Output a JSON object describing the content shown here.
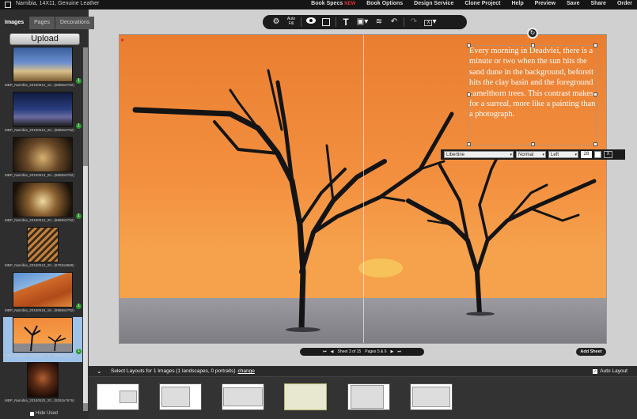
{
  "window": {
    "title": "Namibia, 14X11, Genuine Leather",
    "menu": [
      "Book Specs",
      "Book Options",
      "Design Service",
      "Clone Project",
      "Help",
      "Preview",
      "Save",
      "Share",
      "Order"
    ],
    "menu_new_badge": "NEW"
  },
  "sidebar": {
    "tabs": [
      "Images",
      "Pages",
      "Decorations"
    ],
    "active_tab": "Images",
    "upload_label": "Upload",
    "hide_used_label": "Hide Used",
    "thumbs": [
      {
        "caption": "MBP_Namibia_20150512_16...(8688x5792)",
        "used": true
      },
      {
        "caption": "MBP_Namibia_20150512_20...(8688x5792)",
        "used": true
      },
      {
        "caption": "MBP_Namibia_20150513_20...(8688x5792)",
        "used": false
      },
      {
        "caption": "MBP_Namibia_20150513_20...(8688x5792)",
        "used": true
      },
      {
        "caption": "MBP_Namibia_20150513_20...(5792x8688)",
        "used": false
      },
      {
        "caption": "MBP_Namibia_20150516_16...(8688x5792)",
        "used": true
      },
      {
        "caption": "MBP_Namibia_20150516_16...(8688x5792)",
        "used": true
      },
      {
        "caption": "MBP_Namibia_20150520_20...(5293x7676)",
        "used": false
      }
    ],
    "thumb_badge": "1"
  },
  "toolbar": {
    "items": [
      "gear-icon",
      "auto-fill",
      "eye-icon",
      "frame-icon",
      "text-icon",
      "image-icon",
      "layers-icon",
      "undo-icon",
      "redo-icon",
      "close-icon"
    ],
    "autofill_label": "Auto Fill",
    "text_glyph": "T",
    "close_glyph": "X"
  },
  "page": {
    "text": "Every morning in Deadvlei, there is a minute or two when the sun hits the sand dune in the background, beforeit hits the clay basin and the foreground camelthorn trees. This contrast makes for a surreal, more like a painting than a photograph."
  },
  "fontbar": {
    "font": "Libertine",
    "weight": "Normal",
    "align": "Left",
    "size": "28",
    "close": "X"
  },
  "pager": {
    "sheet_label": "Sheet 3 of 15",
    "pages_label": "Pages 5 & 6",
    "add_sheet": "Add Sheet"
  },
  "layouts": {
    "title": "Select Layouts for 1 Images (1 landscapes, 0 portraits)",
    "change_link": "change",
    "auto_layout_label": "Auto Layout",
    "auto_layout_checked": "✓"
  },
  "colors": {
    "sky_top": "#f08a3a",
    "sky_bottom": "#f6a04a",
    "clay": "#8a8a8e",
    "accent_select": "#9fc2e8",
    "badge_green": "#2a9a2a"
  }
}
